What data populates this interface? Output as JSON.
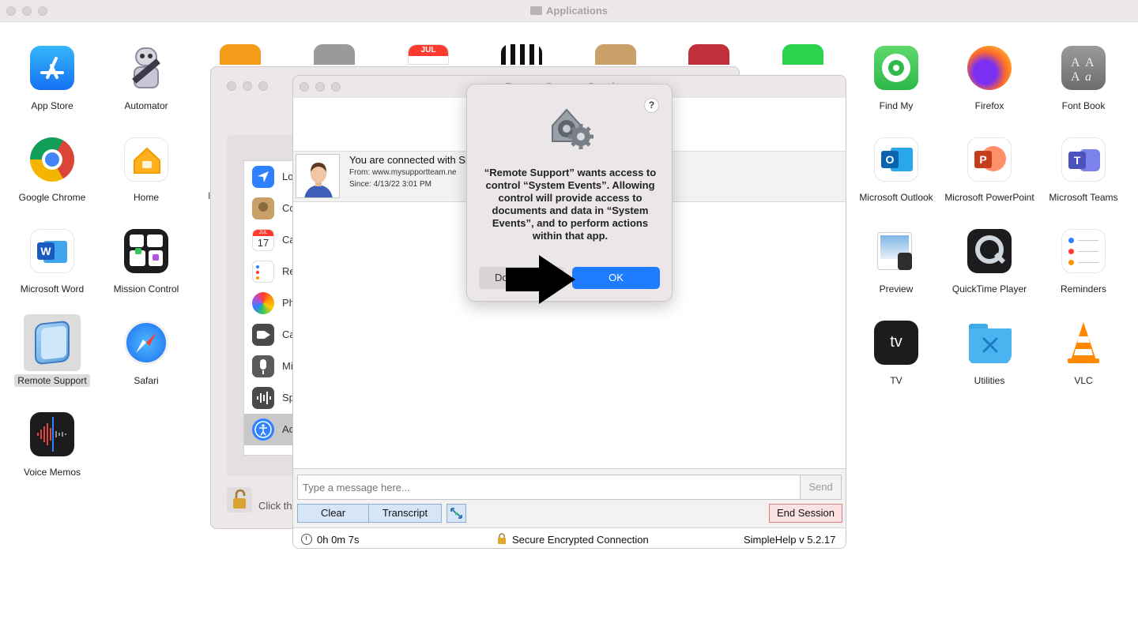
{
  "finder": {
    "title": "Applications",
    "apps": [
      {
        "label": "App Store",
        "icon": "app-store-icon"
      },
      {
        "label": "Automator",
        "icon": "automator-icon"
      },
      {
        "label": "Find My",
        "icon": "find-my-icon"
      },
      {
        "label": "Firefox",
        "icon": "firefox-icon"
      },
      {
        "label": "Font Book",
        "icon": "font-book-icon"
      },
      {
        "label": "Google Chrome",
        "icon": "chrome-icon"
      },
      {
        "label": "Home",
        "icon": "home-icon"
      },
      {
        "label": "Microsoft Outlook",
        "icon": "outlook-icon"
      },
      {
        "label": "Microsoft PowerPoint",
        "icon": "powerpoint-icon"
      },
      {
        "label": "Microsoft Teams",
        "icon": "teams-icon"
      },
      {
        "label": "Microsoft Word",
        "icon": "word-icon"
      },
      {
        "label": "Mission Control",
        "icon": "mission-control-icon"
      },
      {
        "label": "Preview",
        "icon": "preview-icon"
      },
      {
        "label": "QuickTime Player",
        "icon": "quicktime-icon"
      },
      {
        "label": "Reminders",
        "icon": "reminders-icon"
      },
      {
        "label": "Remote Support",
        "icon": "remote-support-icon"
      },
      {
        "label": "Safari",
        "icon": "safari-icon"
      },
      {
        "label": "TV",
        "icon": "tv-icon"
      },
      {
        "label": "Utilities",
        "icon": "utilities-icon"
      },
      {
        "label": "VLC",
        "icon": "vlc-icon"
      },
      {
        "label": "Voice Memos",
        "icon": "voice-memos-icon"
      }
    ]
  },
  "prefs": {
    "partial_label": "I",
    "rows": [
      {
        "label": "Lo"
      },
      {
        "label": "Co"
      },
      {
        "label": "Ca"
      },
      {
        "label": "Re"
      },
      {
        "label": "Ph"
      },
      {
        "label": "Ca"
      },
      {
        "label": "Mi"
      },
      {
        "label": "Sp"
      },
      {
        "label": "Ac"
      }
    ],
    "calendar_month": "JUL",
    "calendar_day": "17",
    "lock_text": "Click th"
  },
  "remote_support": {
    "title_partial": "Remote Support Session",
    "connected_text": "You are connected with Si",
    "from_label": "From:",
    "from_value": "www.mysupportteam.ne",
    "since_label": "Since:",
    "since_value": "4/13/22 3:01 PM",
    "message_placeholder": "Type a message here...",
    "send_label": "Send",
    "clear_label": "Clear",
    "transcript_label": "Transcript",
    "end_session_label": "End Session",
    "elapsed": "0h 0m 7s",
    "secure_label": "Secure Encrypted Connection",
    "version": "SimpleHelp v 5.2.17"
  },
  "dialog": {
    "help_label": "?",
    "message": "“Remote Support” wants access to control “System Events”. Allowing control will provide access to documents and data in “System Events”, and to perform actions within that app.",
    "dont_allow_label": "Do",
    "ok_label": "OK"
  },
  "colors": {
    "accent": "#1f7bff",
    "end_session_border": "#e07d7d",
    "button_blue": "#d6e6f7"
  }
}
